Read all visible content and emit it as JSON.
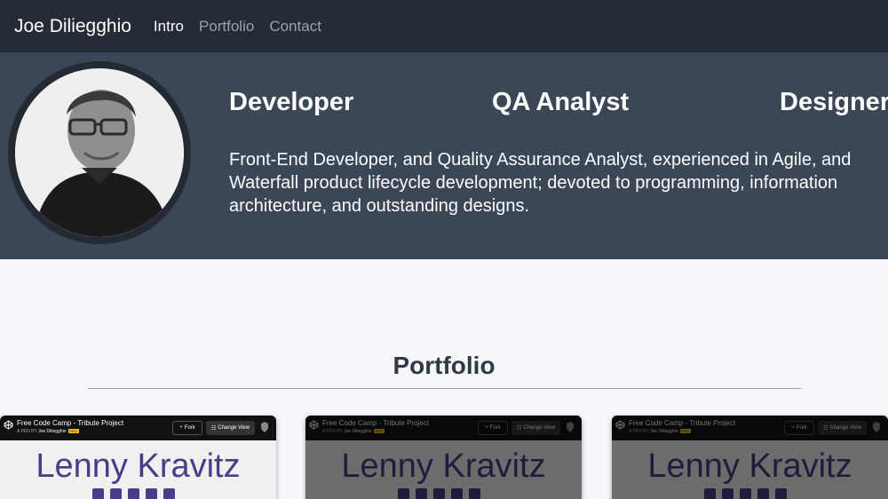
{
  "navbar": {
    "brand": "Joe Diliegghio",
    "links": [
      {
        "label": "Intro",
        "active": true
      },
      {
        "label": "Portfolio",
        "active": false
      },
      {
        "label": "Contact",
        "active": false
      }
    ]
  },
  "hero": {
    "roles": [
      "Developer",
      "QA Analyst",
      "Designer"
    ],
    "bio": "Front-End Developer, and Quality Assurance Analyst, experienced in Agile, and Waterfall product lifecycle development; devoted to programming, information architecture, and outstanding designs."
  },
  "portfolio": {
    "title": "Portfolio",
    "cards": [
      {
        "title": "Free Code Camp - Tribute Project",
        "byline_prefix": "A PEN BY",
        "author": "Joe Diliegghio",
        "badge": "PRO",
        "fork_label": "Fork",
        "view_label": "Change View",
        "preview_name": "Lenny Kravitz",
        "dimmed": false
      },
      {
        "title": "Free Code Camp - Tribute Project",
        "byline_prefix": "A PEN BY",
        "author": "Joe Diliegghio",
        "badge": "PRO",
        "fork_label": "Fork",
        "view_label": "Change View",
        "preview_name": "Lenny Kravitz",
        "dimmed": true
      },
      {
        "title": "Free Code Camp - Tribute Project",
        "byline_prefix": "A PEN BY",
        "author": "Joe Diliegghio",
        "badge": "PRO",
        "fork_label": "Fork",
        "view_label": "Change View",
        "preview_name": "Lenny Kravitz",
        "dimmed": true
      }
    ]
  },
  "colors": {
    "navbar_bg": "#252c36",
    "hero_bg": "#3b4757",
    "page_bg": "#f7f7fb",
    "accent_purple": "#4d3b8a"
  }
}
